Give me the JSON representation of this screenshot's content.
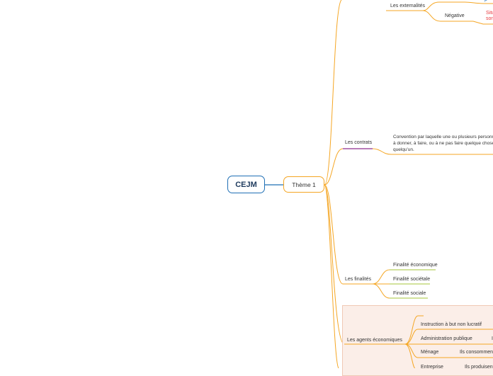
{
  "root": {
    "label": "CEJM"
  },
  "theme": {
    "label": "Thème 1"
  },
  "branches": {
    "externalites": {
      "label": "Les externalités",
      "negative": "Négative",
      "partial_top": "p",
      "partial_red": [
        "Situ",
        "sor"
      ]
    },
    "contrats": {
      "label": "Les contrats",
      "definition": "Convention par laquelle une ou plusieurs personnes à donner, à faire, ou à ne pas faire quelque chose v quelqu'un."
    },
    "finalites": {
      "label": "Les finalités",
      "items": [
        "Finalité économique",
        "Finalité sociétale",
        "Finalité sociale"
      ]
    },
    "agents": {
      "label": "Les agents économiques",
      "items": [
        "Instruction à but non lucratif",
        "Administration publique",
        "Ménage",
        "Entreprise"
      ],
      "details": {
        "admin": "I",
        "menage": "Ils consomment",
        "entreprise": "Ils produisent"
      }
    }
  },
  "colors": {
    "root_border": "#1f6fb5",
    "orange": "#f5a623",
    "purple": "#8e2c8e",
    "green": "#a4c639",
    "panel_fill": "#fbeee8",
    "red_text": "#e8373d"
  }
}
